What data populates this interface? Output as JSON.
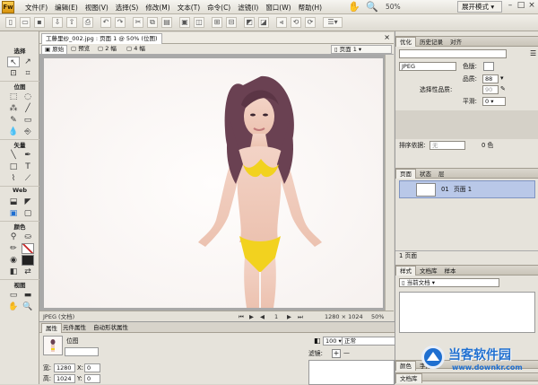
{
  "app": {
    "icon_label": "Fw"
  },
  "menu": [
    "文件(F)",
    "编辑(E)",
    "视图(V)",
    "选择(S)",
    "修改(M)",
    "文本(T)",
    "命令(C)",
    "滤镜(I)",
    "窗口(W)",
    "帮助(H)"
  ],
  "toolbar": {
    "zoom": "50%",
    "layout_mode": "展开模式"
  },
  "tools": {
    "sections": [
      "选择",
      "位图",
      "矢量",
      "Web",
      "颜色",
      "视图"
    ]
  },
  "document": {
    "tab_title": "工藤里纱_002.jpg : 页面 1 @ 50% (位图)",
    "view_tabs": [
      "原始",
      "预览",
      "2 幅",
      "4 幅"
    ],
    "active_view": "原始",
    "page_select": "页面 1"
  },
  "status": {
    "format": "JPEG (文档)",
    "page_number": "1",
    "dimensions": "1280 × 1024",
    "zoom": "50%"
  },
  "properties": {
    "tabs": [
      "属性",
      "元件属性",
      "自动形状属性"
    ],
    "object_type": "位图",
    "width_label": "宽:",
    "width": "1280",
    "height_label": "高:",
    "height": "1024",
    "x_label": "X:",
    "x": "0",
    "y_label": "Y:",
    "y": "0",
    "opacity": "100",
    "blend_mode": "正常",
    "filters_label": "滤镜:"
  },
  "optimize": {
    "tabs": [
      "优化",
      "历史记录",
      "对齐"
    ],
    "format": "JPEG",
    "matte_label": "色版:",
    "quality_label": "品质:",
    "quality": "88",
    "selective_quality_label": "选择性品质:",
    "selective_quality": "90",
    "smoothing_label": "平滑:",
    "smoothing": "0",
    "sort_label": "排序依据:",
    "sort_value": "无",
    "color_count": "0 色"
  },
  "pages": {
    "tabs": [
      "页面",
      "状态",
      "层"
    ],
    "items": [
      {
        "number": "01",
        "name": "页面 1"
      }
    ],
    "footer": "1 页面"
  },
  "styles": {
    "tabs": [
      "样式",
      "文档库",
      "样本"
    ],
    "dropdown": "当前文档"
  },
  "bottom": {
    "tabs": [
      "颜色",
      "字体",
      "文档库"
    ]
  },
  "watermark": {
    "name": "当客软件园",
    "url": "www.downkr.com"
  },
  "colors": {
    "accent": "#1f6fd0",
    "bikini": "#f2d21f",
    "highlight": "#b9c8e8",
    "close_red": "#c62828"
  }
}
